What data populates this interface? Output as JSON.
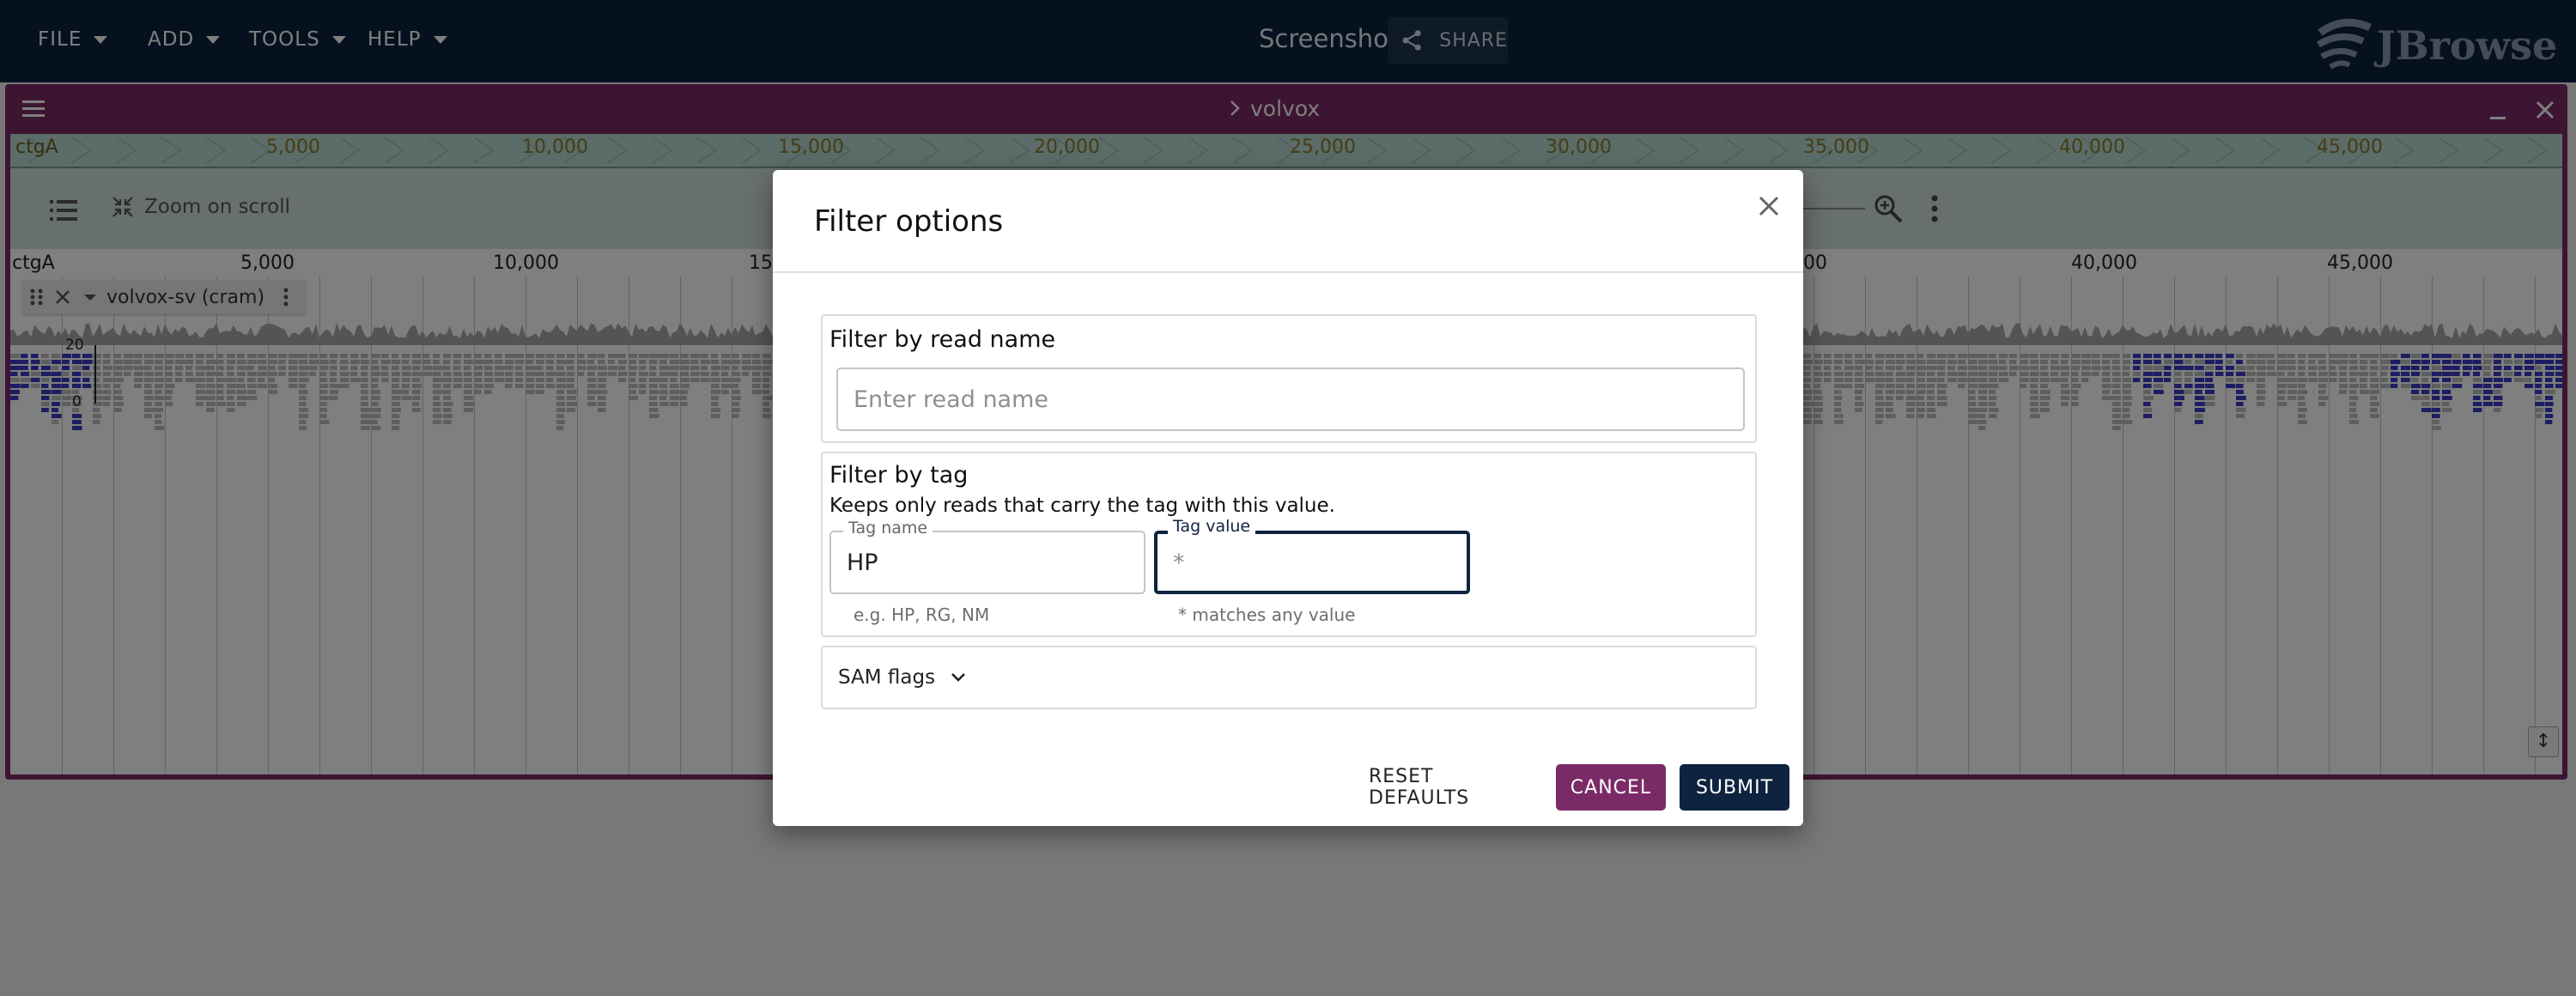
{
  "appbar": {
    "menus": [
      "FILE",
      "ADD",
      "TOOLS",
      "HELP"
    ],
    "session_name": "Screenshot",
    "share_label": "SHARE",
    "logo_text": "JBrowse"
  },
  "view": {
    "title": "volvox",
    "overview_ref": "ctgA",
    "overview_ticks": [
      "5,000",
      "10,000",
      "15,000",
      "20,000",
      "25,000",
      "30,000",
      "35,000",
      "40,000",
      "45,000"
    ],
    "zoom_on_scroll_label": "Zoom on scroll",
    "ruler_ref": "ctgA",
    "ruler_ticks": [
      "5,000",
      "10,000",
      "15,",
      "00",
      "40,000",
      "45,000"
    ],
    "track_name": "volvox-sv (cram)",
    "coverage_scale": [
      "20",
      "0"
    ]
  },
  "dialog": {
    "title": "Filter options",
    "read_name": {
      "title": "Filter by read name",
      "placeholder": "Enter read name",
      "value": ""
    },
    "tag": {
      "title": "Filter by tag",
      "help": "Keeps only reads that carry the tag with this value.",
      "tag_name_label": "Tag name",
      "tag_name_value": "HP",
      "tag_name_helper": "e.g. HP, RG, NM",
      "tag_value_label": "Tag value",
      "tag_value_placeholder": "*",
      "tag_value_helper": "* matches any value"
    },
    "sam_flags_label": "SAM flags",
    "buttons": {
      "reset": "RESET DEFAULTS",
      "cancel": "CANCEL",
      "submit": "SUBMIT"
    }
  },
  "colors": {
    "appbar_bg": "#0d233f",
    "view_frame": "#7a2b67",
    "cancel_bg": "#7a2b67",
    "submit_bg": "#0d233f",
    "focus_outline": "#0d233f"
  }
}
